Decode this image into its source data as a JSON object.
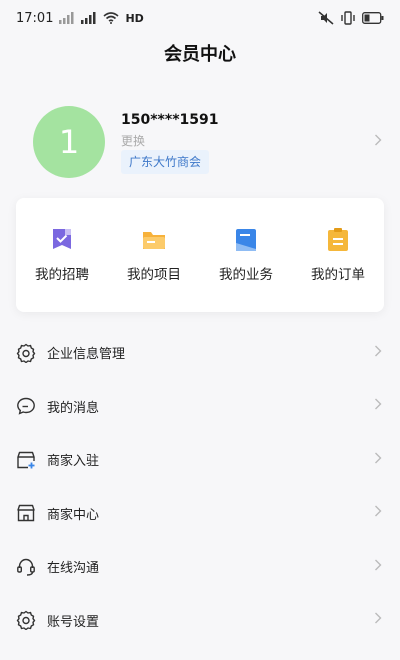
{
  "status": {
    "time": "17:01",
    "network": "HD"
  },
  "nav": {
    "title": "会员中心"
  },
  "profile": {
    "avatar_text": "1",
    "phone": "150****1591",
    "change_label": "更换",
    "org": "广东大竹商会"
  },
  "quick_actions": [
    {
      "label": "我的招聘",
      "icon": "recruit-icon",
      "color": "#7b68e0"
    },
    {
      "label": "我的项目",
      "icon": "folder-icon",
      "color": "#f7b23b"
    },
    {
      "label": "我的业务",
      "icon": "business-icon",
      "color": "#3a86e8"
    },
    {
      "label": "我的订单",
      "icon": "order-icon",
      "color": "#f5b73a"
    }
  ],
  "menu": [
    {
      "label": "企业信息管理",
      "icon": "gear-icon"
    },
    {
      "label": "我的消息",
      "icon": "message-icon"
    },
    {
      "label": "商家入驻",
      "icon": "store-add-icon"
    },
    {
      "label": "商家中心",
      "icon": "store-icon"
    },
    {
      "label": "在线沟通",
      "icon": "headset-icon"
    },
    {
      "label": "账号设置",
      "icon": "settings-icon"
    }
  ]
}
